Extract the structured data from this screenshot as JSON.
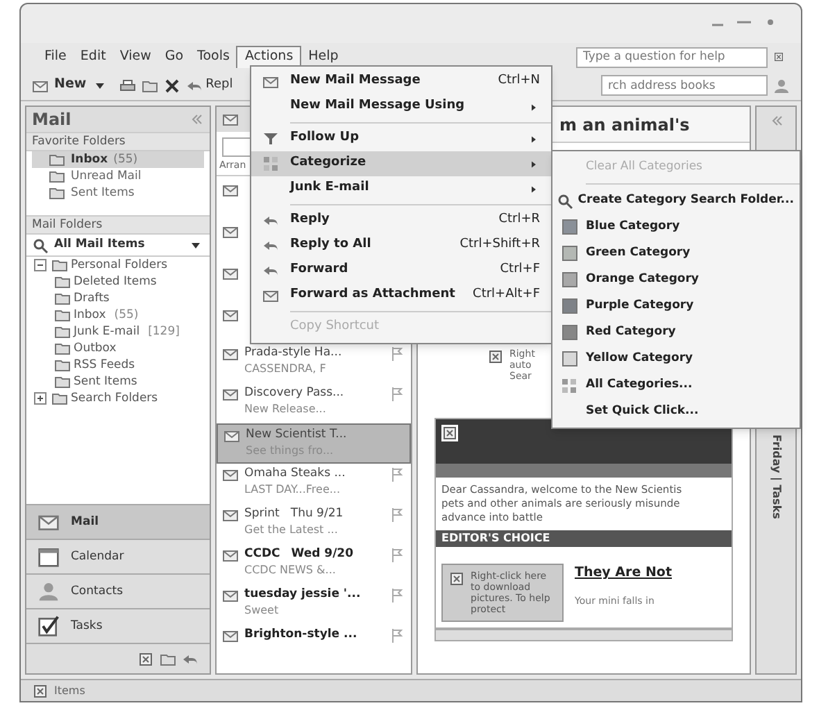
{
  "menu_bar": {
    "menus": [
      {
        "label": "File",
        "selected": false
      },
      {
        "label": "Edit",
        "selected": false
      },
      {
        "label": "View",
        "selected": false
      },
      {
        "label": "Go",
        "selected": false
      },
      {
        "label": "Tools",
        "selected": false
      },
      {
        "label": "Actions",
        "selected": true
      },
      {
        "label": "Help",
        "selected": false
      }
    ],
    "help_box": {
      "placeholder": "Type a question for help"
    }
  },
  "toolbar": {
    "new_button": "New",
    "reply_button": "Repl",
    "address_search": {
      "placeholder": "rch address books"
    }
  },
  "navigation_pane": {
    "title": "Mail",
    "favorite_folders": {
      "title": "Favorite Folders",
      "items": [
        {
          "label": "Inbox",
          "count": "(55)",
          "selected": true
        },
        {
          "label": "Unread Mail",
          "selected": false
        },
        {
          "label": "Sent Items",
          "selected": false
        }
      ]
    },
    "mail_folders": {
      "title": "Mail Folders",
      "view": "All Mail Items",
      "tree": [
        {
          "label": "Personal Folders",
          "expanded": true,
          "children": [
            {
              "label": "Deleted Items"
            },
            {
              "label": "Drafts"
            },
            {
              "label": "Inbox",
              "count": "(55)"
            },
            {
              "label": "Junk E-mail",
              "count": "[129]"
            },
            {
              "label": "Outbox"
            },
            {
              "label": "RSS Feeds"
            },
            {
              "label": "Sent Items"
            }
          ]
        },
        {
          "label": "Search Folders",
          "expanded": false
        }
      ]
    },
    "buttons": [
      {
        "label": "Mail",
        "selected": true
      },
      {
        "label": "Calendar",
        "selected": false
      },
      {
        "label": "Contacts",
        "selected": false
      },
      {
        "label": "Tasks",
        "selected": false
      }
    ]
  },
  "message_list": {
    "arrange_label": "Arran",
    "messages": [
      {
        "sender": "Prada-style Ha...",
        "preview": "CASSENDRA, F",
        "selected": false,
        "unread": false
      },
      {
        "sender": "Discovery Pass...",
        "preview": "New Release...",
        "selected": false,
        "unread": false
      },
      {
        "sender": "New Scientist T...",
        "preview": "See things fro...",
        "selected": true,
        "unread": false
      },
      {
        "sender": "Omaha Steaks ...",
        "preview": "LAST DAY...Free...",
        "selected": false,
        "unread": false
      },
      {
        "sender": "Sprint",
        "date": "Thu 9/21",
        "preview": "Get the Latest ...",
        "selected": false,
        "unread": false
      },
      {
        "sender": "CCDC",
        "date": "Wed 9/20",
        "preview": "CCDC NEWS &...",
        "selected": false,
        "unread": true
      },
      {
        "sender": "tuesday jessie '...",
        "preview": "Sweet",
        "selected": false,
        "unread": true
      },
      {
        "sender": "Brighton-style ...",
        "selected": false,
        "unread": true
      }
    ]
  },
  "reading_pane": {
    "subject": "m an animal's",
    "infobar_lines": [
      "Right",
      "auto",
      "Sear"
    ],
    "email": {
      "greeting": "Dear Cassandra, welcome to the New Scientis",
      "line_2": "pets and other animals are seriously misunde",
      "line_3": "advance into battle",
      "section_title": "EDITOR'S CHOICE",
      "picture_notice": "Right-click here to download pictures. To help protect",
      "headline": "They Are Not",
      "teaser": "Your mini falls in"
    }
  },
  "todo_bar": {
    "label": "Friday | Tasks"
  },
  "status_bar": {
    "text": "Items"
  },
  "actions_menu": {
    "items": [
      {
        "kind": "item",
        "label": "New Mail Message",
        "shortcut": "Ctrl+N",
        "submenu": false,
        "highlighted": false,
        "disabled": false
      },
      {
        "kind": "item",
        "label": "New Mail Message Using",
        "submenu": true,
        "highlighted": false,
        "disabled": false
      },
      {
        "kind": "separator"
      },
      {
        "kind": "item",
        "label": "Follow Up",
        "submenu": true,
        "highlighted": false,
        "disabled": false
      },
      {
        "kind": "item",
        "label": "Categorize",
        "submenu": true,
        "highlighted": true,
        "disabled": false
      },
      {
        "kind": "item",
        "label": "Junk E-mail",
        "submenu": true,
        "highlighted": false,
        "disabled": false
      },
      {
        "kind": "separator"
      },
      {
        "kind": "item",
        "label": "Reply",
        "shortcut": "Ctrl+R",
        "submenu": false,
        "highlighted": false,
        "disabled": false
      },
      {
        "kind": "item",
        "label": "Reply to All",
        "shortcut": "Ctrl+Shift+R",
        "submenu": false,
        "highlighted": false,
        "disabled": false
      },
      {
        "kind": "item",
        "label": "Forward",
        "shortcut": "Ctrl+F",
        "submenu": false,
        "highlighted": false,
        "disabled": false
      },
      {
        "kind": "item",
        "label": "Forward as Attachment",
        "shortcut": "Ctrl+Alt+F",
        "submenu": false,
        "highlighted": false,
        "disabled": false
      },
      {
        "kind": "separator"
      },
      {
        "kind": "item",
        "label": "Copy Shortcut",
        "submenu": false,
        "highlighted": false,
        "disabled": true
      }
    ]
  },
  "categorize_menu": {
    "items": [
      {
        "kind": "action",
        "label": "Clear All Categories",
        "disabled": true
      },
      {
        "kind": "separator"
      },
      {
        "kind": "action",
        "label": "Create Category Search Folder...",
        "disabled": false
      },
      {
        "kind": "category",
        "label": "Blue Category",
        "color": "#8a9098"
      },
      {
        "kind": "category",
        "label": "Green Category",
        "color": "#b4b8b4"
      },
      {
        "kind": "category",
        "label": "Orange Category",
        "color": "#a8a8a8"
      },
      {
        "kind": "category",
        "label": "Purple Category",
        "color": "#7e8288"
      },
      {
        "kind": "category",
        "label": "Red Category",
        "color": "#868686"
      },
      {
        "kind": "category",
        "label": "Yellow Category",
        "color": "#d8d8d8"
      },
      {
        "kind": "action",
        "label": "All Categories...",
        "disabled": false
      },
      {
        "kind": "action",
        "label": "Set Quick Click...",
        "disabled": false
      }
    ]
  }
}
